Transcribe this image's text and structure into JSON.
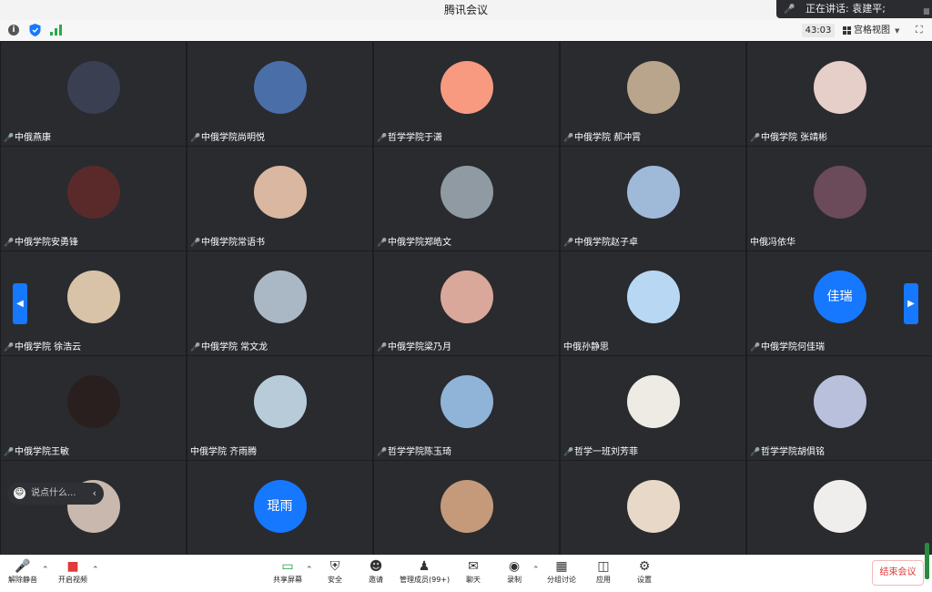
{
  "window": {
    "title": "腾讯会议"
  },
  "speaking": {
    "text": "正在讲话: 袁建平;"
  },
  "infobar": {
    "timer": "43:03",
    "view_label": "宫格视图"
  },
  "participants": [
    {
      "name": "中俄燕康",
      "muted": true,
      "avatar_color": "#3a3f52"
    },
    {
      "name": "中俄学院尚明悦",
      "muted": true,
      "avatar_color": "#4a6ea8"
    },
    {
      "name": "哲学学院于潇",
      "muted": true,
      "avatar_color": "#f79a80"
    },
    {
      "name": "中俄学院 郝冲霄",
      "muted": true,
      "avatar_color": "#b9a48c"
    },
    {
      "name": "中俄学院 张靖彬",
      "muted": true,
      "avatar_color": "#e6cfc8"
    },
    {
      "name": "中俄学院安勇锋",
      "muted": true,
      "avatar_color": "#5a2a2a"
    },
    {
      "name": "中俄学院常语书",
      "muted": true,
      "avatar_color": "#d9b7a0"
    },
    {
      "name": "中俄学院郑皓文",
      "muted": true,
      "avatar_color": "#8f9aa3"
    },
    {
      "name": "中俄学院赵子卓",
      "muted": true,
      "avatar_color": "#9fb9d8"
    },
    {
      "name": "中俄冯依华",
      "muted": false,
      "avatar_color": "#6b4a5a"
    },
    {
      "name": "中俄学院 徐浩云",
      "muted": true,
      "avatar_color": "#d8c3a8"
    },
    {
      "name": "中俄学院 常文龙",
      "muted": true,
      "avatar_color": "#a9b8c4"
    },
    {
      "name": "中俄学院梁乃月",
      "muted": true,
      "avatar_color": "#d9a89a"
    },
    {
      "name": "中俄孙静思",
      "muted": false,
      "avatar_color": "#b8d7f2"
    },
    {
      "name": "中俄学院何佳瑞",
      "muted": true,
      "avatar_color": "#1677ff",
      "avatar_text": "佳瑞"
    },
    {
      "name": "中俄学院王敏",
      "muted": true,
      "avatar_color": "#2a1f1f"
    },
    {
      "name": "中俄学院 齐雨腾",
      "muted": false,
      "avatar_color": "#b7cbd9"
    },
    {
      "name": "哲学学院陈玉琦",
      "muted": true,
      "avatar_color": "#8fb4d8"
    },
    {
      "name": "哲学一班刘芳菲",
      "muted": true,
      "avatar_color": "#eeeae4"
    },
    {
      "name": "哲学学院胡俱铭",
      "muted": true,
      "avatar_color": "#b9c0dc"
    },
    {
      "name": "",
      "muted": true,
      "avatar_color": "#c9b8ae"
    },
    {
      "name": "",
      "muted": true,
      "avatar_color": "#1677ff",
      "avatar_text": "琨雨"
    },
    {
      "name": "",
      "muted": true,
      "avatar_color": "#c49a7a"
    },
    {
      "name": "",
      "muted": true,
      "avatar_color": "#e8d8c8"
    },
    {
      "name": "",
      "muted": true,
      "avatar_color": "#f0eeec"
    }
  ],
  "chat": {
    "placeholder": "说点什么..."
  },
  "toolbar": {
    "unmute": "解除静音",
    "start_video": "开启视频",
    "share_screen": "共享屏幕",
    "security": "安全",
    "invite": "邀请",
    "manage_members": "管理成员(99+)",
    "chat": "聊天",
    "record": "录制",
    "breakout": "分组讨论",
    "apps": "应用",
    "settings": "设置",
    "end_meeting": "结束会议"
  }
}
